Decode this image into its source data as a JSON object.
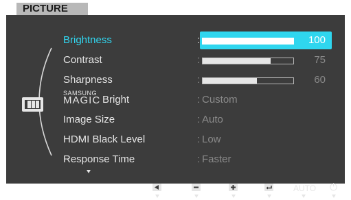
{
  "menu": {
    "title": "PICTURE",
    "items": [
      {
        "label": "Brightness",
        "value": "100",
        "level": 1.0,
        "highlighted": true
      },
      {
        "label": "Contrast",
        "value": "75",
        "level": 0.75
      },
      {
        "label": "Sharpness",
        "value": "60",
        "level": 0.6
      },
      {
        "label": "Bright",
        "value": "Custom",
        "brand_top": "SAMSUNG",
        "brand_main": "MAGIC"
      },
      {
        "label": "Image Size",
        "value": "Auto"
      },
      {
        "label": "HDMI Black Level",
        "value": "Low"
      },
      {
        "label": "Response Time",
        "value": "Faster"
      }
    ],
    "colon": ":"
  },
  "bottom_bar": {
    "keys": [
      {
        "name": "left-key",
        "icon": "left-arrow-icon"
      },
      {
        "name": "minus-key",
        "icon": "minus-icon"
      },
      {
        "name": "plus-key",
        "icon": "plus-icon"
      },
      {
        "name": "enter-key",
        "icon": "enter-icon"
      },
      {
        "name": "auto-key",
        "label": "AUTO"
      },
      {
        "name": "power-key",
        "icon": "power-icon",
        "glyph": "⏻"
      }
    ]
  },
  "colors": {
    "accent": "#31d8f2",
    "panel": "#3c3c3c",
    "title_tab": "#b8b8b8"
  }
}
